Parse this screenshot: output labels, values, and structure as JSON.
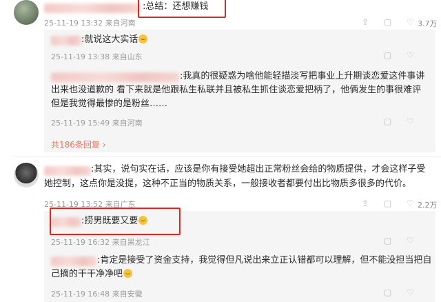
{
  "comments": [
    {
      "text": ":总结：还想赚钱",
      "time": "25-11-19 13:32 来自河南",
      "likes": "3.7万",
      "replies": [
        {
          "text": ":就说这大实话",
          "time": "25-11-19 13:38 来自山东"
        },
        {
          "line1": ":我真的很疑惑为啥他能轻描淡写把事业上升期谈恋爱这件事讲",
          "line2": "出来也没道歉的  看下来就是他跟私生私联并且被私生抓住谈恋爱把柄了，他俩发生的事很难评",
          "line3": "但是我觉得最惨的是粉丝……",
          "time": "25-11-19 15:49 来自河南"
        }
      ],
      "more_replies": "共186条回复"
    },
    {
      "line1": ":其实，说句实在话，应该是你有接受她超出正常粉丝会给的物质提供，才会这样子受",
      "line2": "她控制，这点你是没提，这种不正当的物质关系，一般接收者都要付出比物质多很多的代价。",
      "time": "25-11-19 13:52 来自广东",
      "likes": "2.2万",
      "replies": [
        {
          "text": ":捞男既要又要",
          "time": "25-11-19 16:32 来自黑龙江"
        },
        {
          "line1": ":肯定是接受了资金支持，我觉得但凡说出来立正认错都可以理解，但不能没担当把自",
          "line2": "己摘的干干净净吧",
          "time": "25-11-19 16:48 来自安徽"
        }
      ]
    }
  ]
}
